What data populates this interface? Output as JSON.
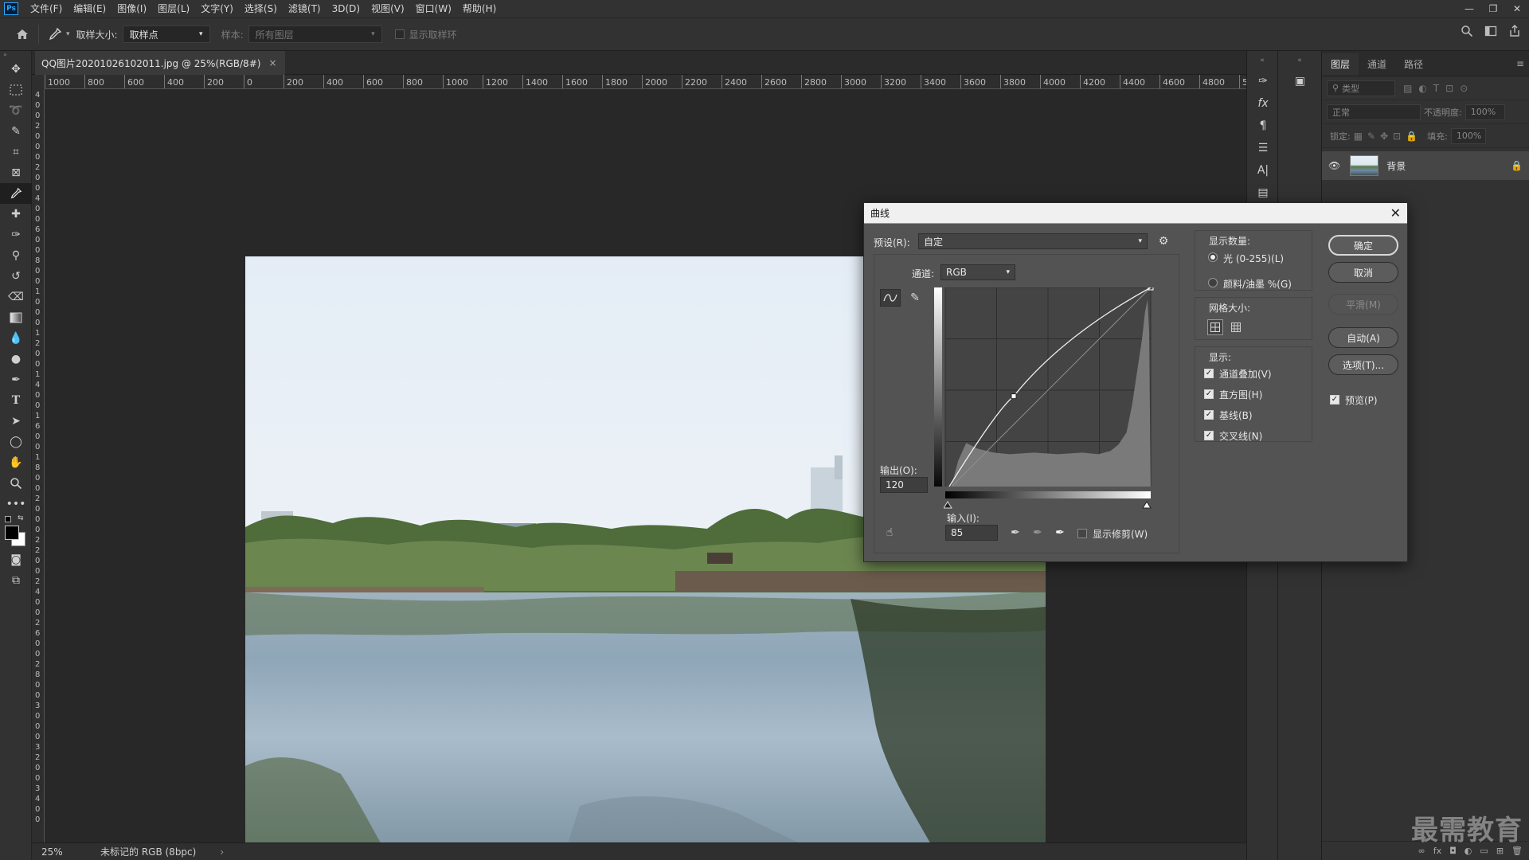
{
  "app": {
    "logo": "Ps",
    "menu": [
      "文件(F)",
      "编辑(E)",
      "图像(I)",
      "图层(L)",
      "文字(Y)",
      "选择(S)",
      "滤镜(T)",
      "3D(D)",
      "视图(V)",
      "窗口(W)",
      "帮助(H)"
    ],
    "window_controls": [
      "—",
      "❐",
      "✕"
    ]
  },
  "options": {
    "sample_size_label": "取样大小:",
    "sample_size_value": "取样点",
    "sample_label": "样本:",
    "sample_value": "所有图层",
    "show_ring_label": "显示取样环"
  },
  "document": {
    "tab_title": "QQ图片20201026102011.jpg @ 25%(RGB/8#)",
    "close": "×",
    "zoom": "25%",
    "profile": "未标记的 RGB (8bpc)",
    "ruler_h": [
      "1000",
      "800",
      "600",
      "400",
      "200",
      "0",
      "200",
      "400",
      "600",
      "800",
      "1000",
      "1200",
      "1400",
      "1600",
      "1800",
      "2000",
      "2200",
      "2400",
      "2600",
      "2800",
      "3000",
      "3200",
      "3400",
      "3600",
      "3800",
      "4000",
      "4200",
      "4400",
      "4600",
      "4800",
      "5"
    ],
    "ruler_v": [
      "4",
      "0",
      "0",
      "2",
      "0",
      "0",
      "0",
      "2",
      "0",
      "0",
      "4",
      "0",
      "0",
      "6",
      "0",
      "0",
      "8",
      "0",
      "0",
      "1",
      "0",
      "0",
      "0",
      "1",
      "2",
      "0",
      "0",
      "1",
      "4",
      "0",
      "0",
      "1",
      "6",
      "0",
      "0",
      "1",
      "8",
      "0",
      "0",
      "2",
      "0",
      "0",
      "0",
      "2",
      "2",
      "0",
      "0",
      "2",
      "4",
      "0",
      "0",
      "2",
      "6",
      "0",
      "0",
      "2",
      "8",
      "0",
      "0",
      "3",
      "0",
      "0",
      "0",
      "3",
      "2",
      "0",
      "0",
      "3",
      "4",
      "0",
      "0"
    ]
  },
  "layers_panel": {
    "tabs": [
      "图层",
      "通道",
      "路径"
    ],
    "filter_placeholder": "类型",
    "blend_mode": "正常",
    "opacity_label": "不透明度:",
    "opacity_value": "100%",
    "lock_label": "锁定:",
    "fill_label": "填充:",
    "fill_value": "100%",
    "layer_name": "背景"
  },
  "curves": {
    "title": "曲线",
    "close": "✕",
    "preset_label": "预设(R):",
    "preset_value": "自定",
    "channel_label": "通道:",
    "channel_value": "RGB",
    "output_label": "输出(O):",
    "output_value": "120",
    "input_label": "输入(I):",
    "input_value": "85",
    "show_clipping_label": "显示修剪(W)",
    "show_amount_label": "显示数量:",
    "light_label": "光 (0-255)(L)",
    "pigment_label": "颜料/油墨 %(G)",
    "grid_size_label": "网格大小:",
    "show_label": "显示:",
    "channel_overlay_label": "通道叠加(V)",
    "histogram_label": "直方图(H)",
    "baseline_label": "基线(B)",
    "intersection_label": "交叉线(N)",
    "ok_label": "确定",
    "cancel_label": "取消",
    "smooth_label": "平滑(M)",
    "auto_label": "自动(A)",
    "options_label": "选项(T)...",
    "preview_label": "预览(P)",
    "control_point": {
      "input": 85,
      "output": 120
    }
  },
  "watermark": "最需教育"
}
